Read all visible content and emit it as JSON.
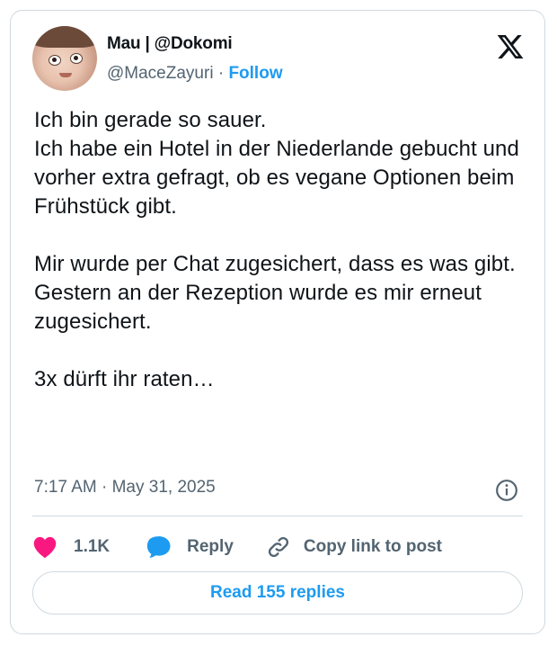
{
  "author": {
    "display_name": "Mau | @Dokomi",
    "handle": "@MaceZayuri",
    "separator": " · ",
    "follow_label": "Follow"
  },
  "tweet": {
    "text": "Ich bin gerade so sauer.\nIch habe ein Hotel in der Niederlande gebucht und vorher extra gefragt, ob es vegane Optionen beim Frühstück gibt.\n\nMir wurde per Chat zugesichert, dass es was gibt.\nGestern an der Rezeption wurde es mir erneut zugesichert.\n\n3x dürft ihr raten…",
    "timestamp": "7:17 AM · May 31, 2025"
  },
  "actions": {
    "like_count": "1.1K",
    "reply_label": "Reply",
    "copy_link_label": "Copy link to post"
  },
  "read_replies_label": "Read 155 replies",
  "colors": {
    "accent": "#1d9bf0",
    "like": "#f91880",
    "muted": "#536471",
    "border": "#cfd9de"
  },
  "icons": [
    "x-logo-icon",
    "info-icon",
    "heart-icon",
    "reply-bubble-icon",
    "link-icon"
  ]
}
